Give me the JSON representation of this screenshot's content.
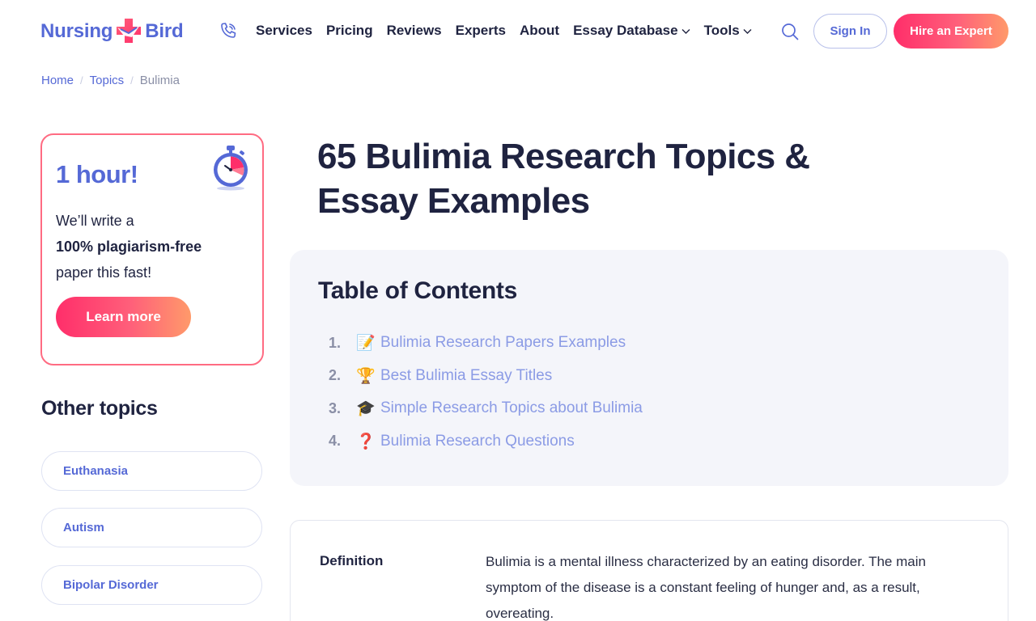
{
  "header": {
    "logo": {
      "left": "Nursing",
      "right": "Bird"
    },
    "nav": [
      {
        "label": "Services",
        "dropdown": false
      },
      {
        "label": "Pricing",
        "dropdown": false
      },
      {
        "label": "Reviews",
        "dropdown": false
      },
      {
        "label": "Experts",
        "dropdown": false
      },
      {
        "label": "About",
        "dropdown": false
      },
      {
        "label": "Essay Database",
        "dropdown": true
      },
      {
        "label": "Tools",
        "dropdown": true
      }
    ],
    "sign_in": "Sign In",
    "hire": "Hire an Expert"
  },
  "breadcrumb": {
    "home": "Home",
    "topics": "Topics",
    "current": "Bulimia",
    "separator": "/"
  },
  "promo": {
    "title": "1 hour!",
    "line1": "We’ll write a",
    "line2": "100% plagiarism-free",
    "line3": "paper this fast!",
    "button": "Learn more"
  },
  "sidebar": {
    "other_topics_title": "Other topics",
    "topics": [
      "Euthanasia",
      "Autism",
      "Bipolar Disorder"
    ]
  },
  "main": {
    "title": "65 Bulimia Research Topics & Essay Examples",
    "toc": {
      "title": "Table of Contents",
      "items": [
        {
          "num": "1.",
          "emoji": "📝",
          "label": "Bulimia Research Papers Examples"
        },
        {
          "num": "2.",
          "emoji": "🏆",
          "label": "Best Bulimia Essay Titles"
        },
        {
          "num": "3.",
          "emoji": "🎓",
          "label": "Simple Research Topics about Bulimia"
        },
        {
          "num": "4.",
          "emoji": "❓",
          "label": "Bulimia Research Questions"
        }
      ]
    },
    "definition": {
      "label": "Definition",
      "text": "Bulimia is a mental illness characterized by an eating disorder. The main symptom of the disease is a constant feeling of hunger and, as a result, overeating."
    }
  },
  "colors": {
    "brand_blue": "#5569d6",
    "accent_pink": "#ff2e6a",
    "text_dark": "#1f2340",
    "link_light": "#8b9be5"
  }
}
